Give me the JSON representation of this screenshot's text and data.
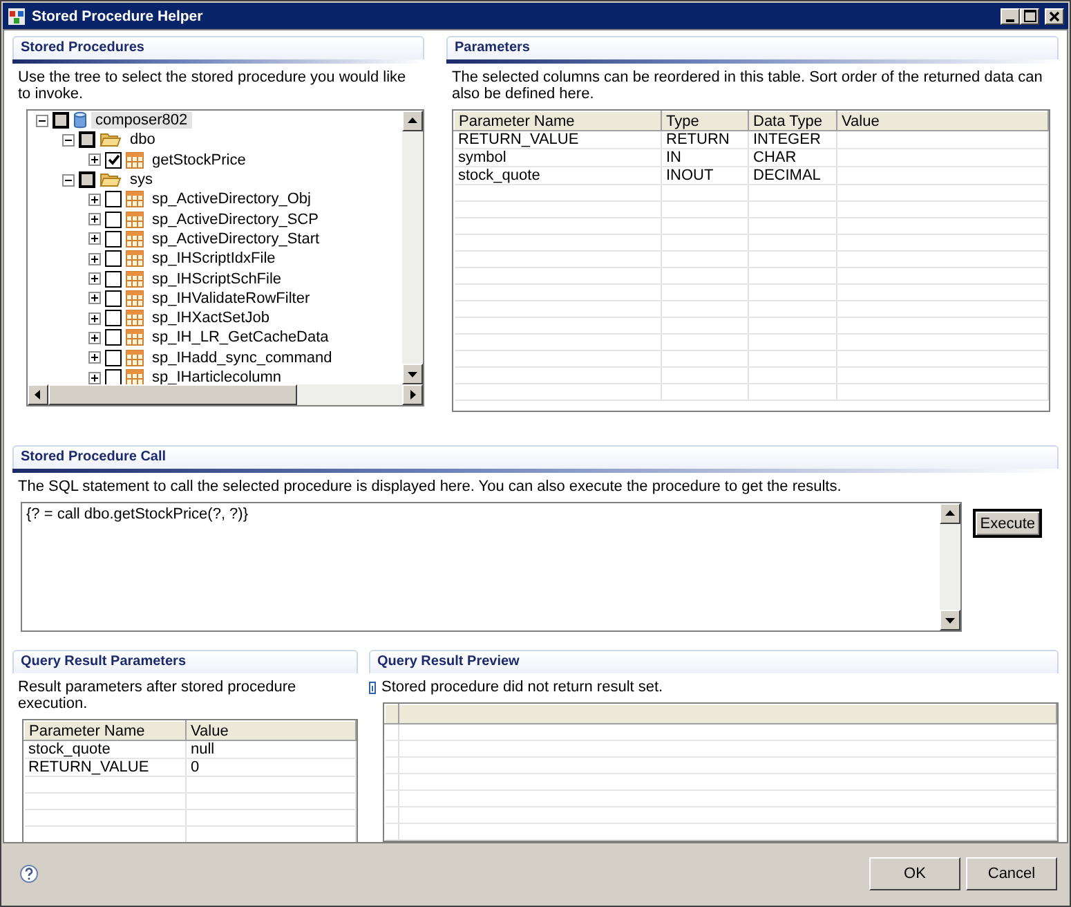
{
  "window": {
    "title": "Stored Procedure Helper"
  },
  "stored_procedures": {
    "title": "Stored Procedures",
    "description": "Use the tree to select the stored procedure you would like to invoke.",
    "tree": [
      {
        "label": "composer802",
        "kind": "database",
        "expanded": true,
        "checked": false,
        "grayed": true,
        "selected": true,
        "children": [
          {
            "label": "dbo",
            "kind": "folder",
            "expanded": true,
            "checked": false,
            "grayed": true,
            "selected": false,
            "children": [
              {
                "label": "getStockPrice",
                "kind": "procedure",
                "expanded": false,
                "checked": true,
                "grayed": false,
                "selected": false
              }
            ]
          },
          {
            "label": "sys",
            "kind": "folder",
            "expanded": true,
            "checked": false,
            "grayed": true,
            "selected": false,
            "children": [
              {
                "label": "sp_ActiveDirectory_Obj",
                "kind": "procedure",
                "expanded": false,
                "checked": false,
                "grayed": false,
                "selected": false
              },
              {
                "label": "sp_ActiveDirectory_SCP",
                "kind": "procedure",
                "expanded": false,
                "checked": false,
                "grayed": false,
                "selected": false
              },
              {
                "label": "sp_ActiveDirectory_Start",
                "kind": "procedure",
                "expanded": false,
                "checked": false,
                "grayed": false,
                "selected": false
              },
              {
                "label": "sp_IHScriptIdxFile",
                "kind": "procedure",
                "expanded": false,
                "checked": false,
                "grayed": false,
                "selected": false
              },
              {
                "label": "sp_IHScriptSchFile",
                "kind": "procedure",
                "expanded": false,
                "checked": false,
                "grayed": false,
                "selected": false
              },
              {
                "label": "sp_IHValidateRowFilter",
                "kind": "procedure",
                "expanded": false,
                "checked": false,
                "grayed": false,
                "selected": false
              },
              {
                "label": "sp_IHXactSetJob",
                "kind": "procedure",
                "expanded": false,
                "checked": false,
                "grayed": false,
                "selected": false
              },
              {
                "label": "sp_IH_LR_GetCacheData",
                "kind": "procedure",
                "expanded": false,
                "checked": false,
                "grayed": false,
                "selected": false
              },
              {
                "label": "sp_IHadd_sync_command",
                "kind": "procedure",
                "expanded": false,
                "checked": false,
                "grayed": false,
                "selected": false
              },
              {
                "label": "sp_IHarticlecolumn",
                "kind": "procedure",
                "expanded": false,
                "checked": false,
                "grayed": false,
                "selected": false
              }
            ]
          }
        ]
      }
    ]
  },
  "parameters": {
    "title": "Parameters",
    "description": "The selected columns can be reordered in this table.  Sort order of the returned data can also be defined here.",
    "columns": [
      "Parameter Name",
      "Type",
      "Data Type",
      "Value"
    ],
    "rows": [
      [
        "RETURN_VALUE",
        "RETURN",
        "INTEGER",
        ""
      ],
      [
        "symbol",
        "IN",
        "CHAR",
        ""
      ],
      [
        "stock_quote",
        "INOUT",
        "DECIMAL",
        ""
      ]
    ]
  },
  "procedure_call": {
    "title": "Stored Procedure Call",
    "description": "The SQL statement to call the selected procedure is displayed here.  You can also execute the procedure to get the results.",
    "sql": "{? = call dbo.getStockPrice(?, ?)}",
    "button": "Execute"
  },
  "result_parameters": {
    "title": "Query Result Parameters",
    "description": "Result parameters after stored procedure execution.",
    "columns": [
      "Parameter Name",
      "Value"
    ],
    "rows": [
      [
        "stock_quote",
        "null"
      ],
      [
        "RETURN_VALUE",
        "0"
      ]
    ]
  },
  "result_preview": {
    "title": "Query Result Preview",
    "message": "Stored procedure did not return result set."
  },
  "buttons": [
    "OK",
    "Cancel"
  ]
}
